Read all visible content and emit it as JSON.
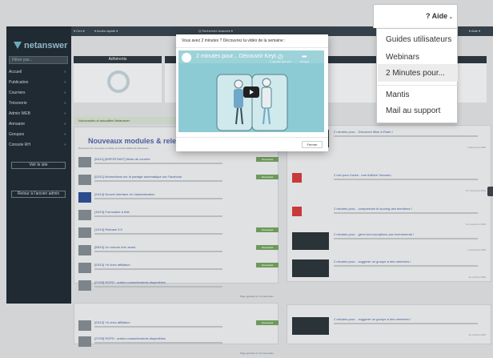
{
  "topbar": {
    "app_name": "netanswer",
    "brand": "netanswer",
    "crm": "▾ Crm ▾",
    "acces_rapide": "▾ Accès rapide ▾",
    "recherche": "Q Recherche avancée ▾",
    "user": "▾ Aide ▾"
  },
  "sidebar": {
    "search_placeholder": "Filtrer par...",
    "items": [
      "Accueil",
      "Publication",
      "Courriers",
      "Trésorerie",
      "Admin WEB",
      "Annuaire",
      "Groupes",
      "Console RH"
    ],
    "view_site": "Voir le site",
    "back_button": "Retour à l'ancien admin"
  },
  "dashboard": {
    "stat_label": "Adhérents",
    "news_banner": "Nouveautés et actualités Netanswer",
    "panel_title": "Nouveaux modules & releases",
    "panel_desc": "Découvrez les nouveaux modules et fonctionnalités de Netanswer",
    "rows": [
      {
        "title": "[04/11] [IMPORTANT] Mode de courrier",
        "badge": "Nouveauté"
      },
      {
        "title": "[02/11] Informations sur le partage automatique sur Facebook",
        "badge": "Nouveauté"
      },
      {
        "title": "[24/10] Nouvel interface de l'administration",
        "badge": ""
      },
      {
        "title": "[16/10] Formulaire à état",
        "badge": ""
      },
      {
        "title": "[12/10] Release 3.5",
        "badge": "Nouveauté"
      },
      {
        "title": "[08/10] Un monde d'en avant",
        "badge": "Nouveauté"
      },
      {
        "title": "[03/10] Yé chez affiliation",
        "badge": "Nouveauté"
      },
      {
        "title": "[27/09] RGPD : autres consentements disponibles",
        "badge": ""
      }
    ],
    "rows2": [
      {
        "title": "[03/10] Yé chez affiliation",
        "badge": "Nouveauté"
      },
      {
        "title": "[27/09] RGPD : autres consentements disponibles",
        "badge": ""
      }
    ],
    "footer": "Page générée en 0.4 secondes",
    "right_items": [
      {
        "title": "2 minutes pour... Découvrir Mise à Flash !",
        "date": "2 décembre 2018"
      },
      {
        "title": "2 min pour l'ordre : une éditrice Yacoubu",
        "date": "27 novembre 2018"
      },
      {
        "title": "2 minutes pour... comprendre le scoring des membres !",
        "date": "14 novembre 2018"
      },
      {
        "title": "2 minutes pour... gérer les inscriptions aux événements !",
        "date": "7 novembre 2018"
      },
      {
        "title": "2 minutes pour... suggérer un groupe à des membres !",
        "date": "31 octobre 2018"
      },
      {
        "title": "2 minutes pour... suggérer un groupe à des membres !",
        "date": "31 octobre 2018"
      }
    ]
  },
  "modal": {
    "title": "Vous avez 2 minutes ? Découvrez la vidéo de la semaine :",
    "video_title": "2 minutes pour... Découvrir Keyt...",
    "watch_later": "À regarder plus tard",
    "share": "Partager",
    "close_button": "Fermer"
  },
  "help_menu": {
    "label": "? Aide",
    "items": [
      "Guides utilisateurs",
      "Webinars",
      "2 Minutes pour...",
      "Mantis",
      "Mail au support"
    ],
    "highlighted_index": 2
  },
  "colors": {
    "sidebar": "#1f2a33",
    "accent": "#4a5fa0",
    "badge": "#6d9a5b"
  }
}
